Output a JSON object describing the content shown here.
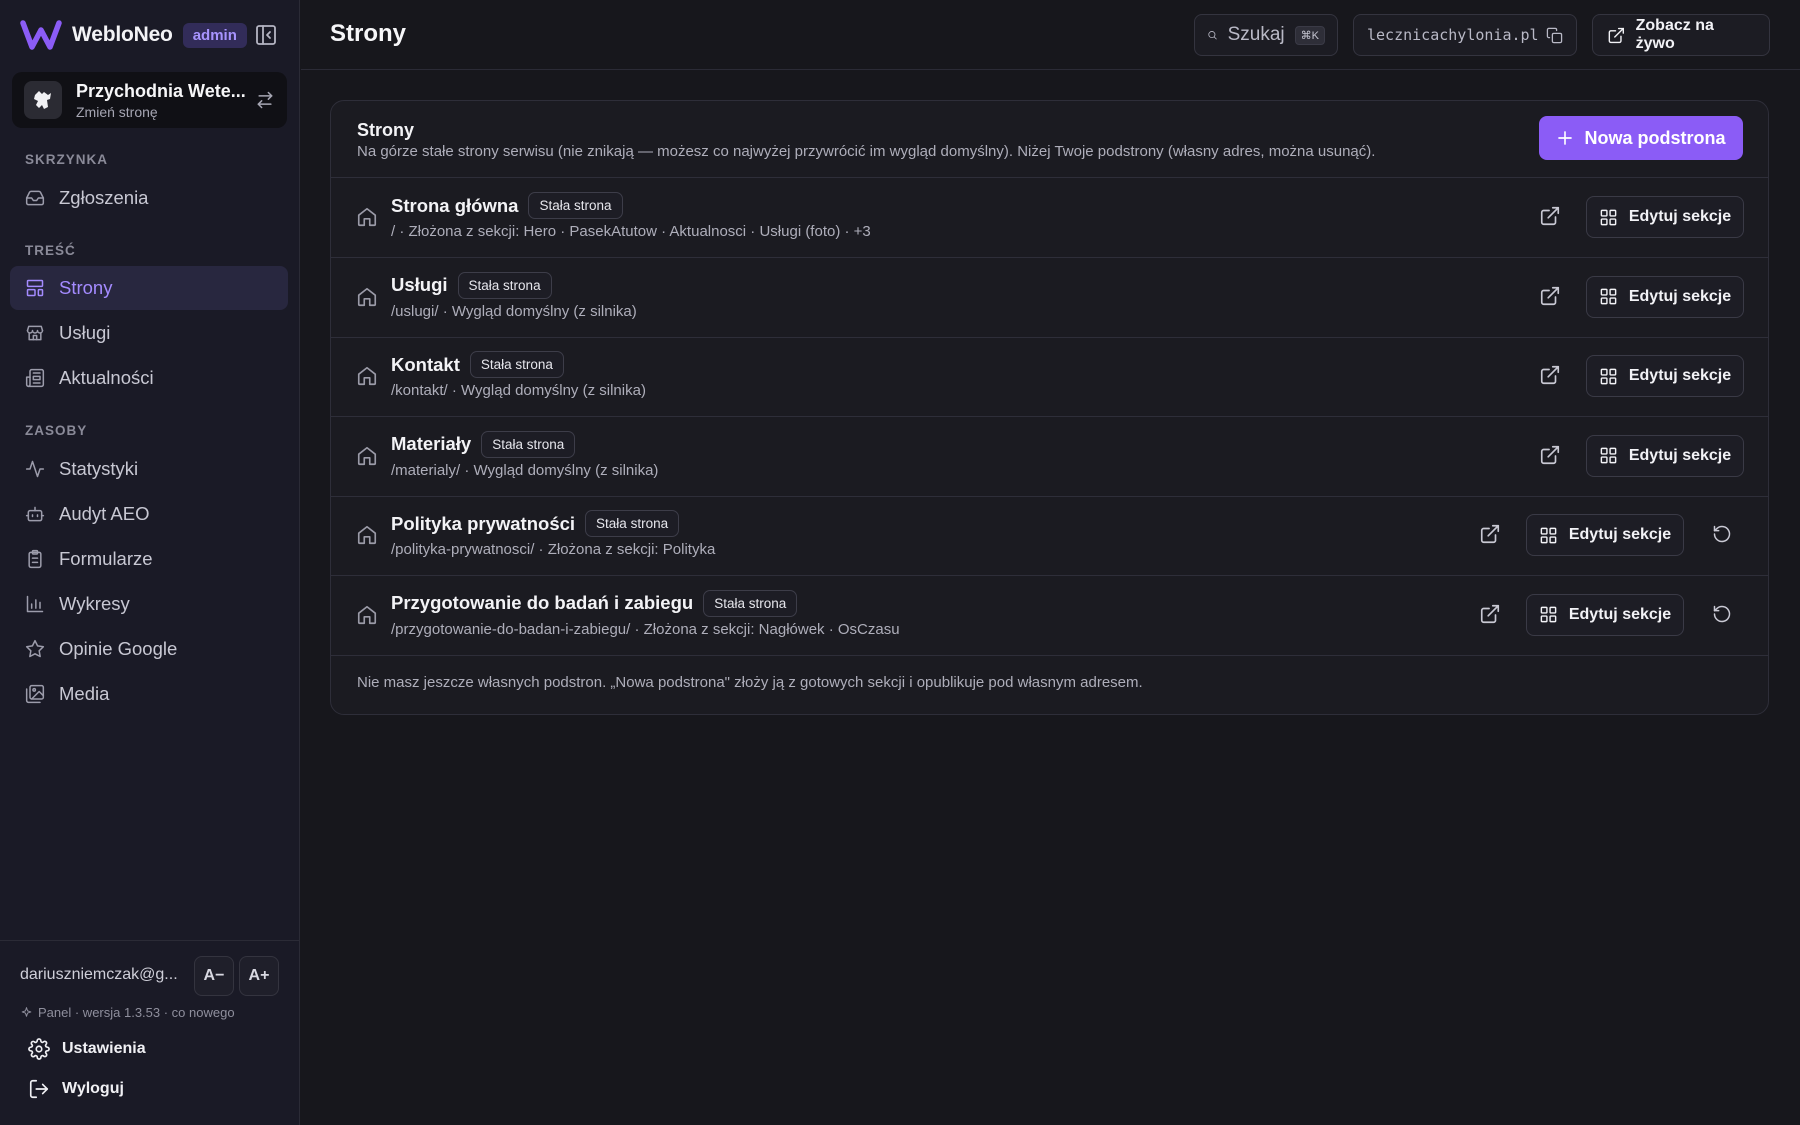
{
  "brand": {
    "name": "WebloNeo",
    "role_badge": "admin"
  },
  "site": {
    "name": "Przychodnia Wete...",
    "change_label": "Zmień stronę"
  },
  "sidebar": {
    "sections": [
      {
        "title": "SKRZYNKA",
        "items": [
          {
            "label": "Zgłoszenia",
            "icon": "inbox-icon"
          }
        ]
      },
      {
        "title": "TREŚĆ",
        "items": [
          {
            "label": "Strony",
            "icon": "layout-icon",
            "active": true
          },
          {
            "label": "Usługi",
            "icon": "store-icon"
          },
          {
            "label": "Aktualności",
            "icon": "newspaper-icon"
          }
        ]
      },
      {
        "title": "ZASOBY",
        "items": [
          {
            "label": "Statystyki",
            "icon": "activity-icon"
          },
          {
            "label": "Audyt AEO",
            "icon": "bot-icon"
          },
          {
            "label": "Formularze",
            "icon": "clipboard-icon"
          },
          {
            "label": "Wykresy",
            "icon": "bar-chart-icon"
          },
          {
            "label": "Opinie Google",
            "icon": "star-icon"
          },
          {
            "label": "Media",
            "icon": "images-icon"
          }
        ]
      }
    ],
    "footer": {
      "email": "dariuszniemczak@g...",
      "font_decrease": "A−",
      "font_increase": "A+",
      "version": "Panel · wersja 1.3.53 · co nowego",
      "settings_label": "Ustawienia",
      "logout_label": "Wyloguj"
    }
  },
  "topbar": {
    "title": "Strony",
    "search_label": "Szukaj",
    "search_shortcut": "⌘K",
    "domain": "lecznicachylonia.pl",
    "live_label": "Zobacz na żywo"
  },
  "pages_card": {
    "title": "Strony",
    "description": "Na górze stałe strony serwisu (nie znikają — możesz co najwyżej przywrócić im wygląd domyślny). Niżej Twoje podstrony (własny adres, można usunąć).",
    "new_button": "Nowa podstrona",
    "edit_label": "Edytuj sekcje",
    "fixed_badge": "Stała strona",
    "rows": [
      {
        "title": "Strona główna",
        "sub": "/ · Złożona z sekcji: Hero · PasekAtutow · Aktualnosci · Usługi (foto) · +3",
        "resettable": false
      },
      {
        "title": "Usługi",
        "sub": "/uslugi/ · Wygląd domyślny (z silnika)",
        "resettable": false
      },
      {
        "title": "Kontakt",
        "sub": "/kontakt/ · Wygląd domyślny (z silnika)",
        "resettable": false
      },
      {
        "title": "Materiały",
        "sub": "/materialy/ · Wygląd domyślny (z silnika)",
        "resettable": false
      },
      {
        "title": "Polityka prywatności",
        "sub": "/polityka-prywatnosci/ · Złożona z sekcji: Polityka",
        "resettable": true
      },
      {
        "title": "Przygotowanie do badań i zabiegu",
        "sub": "/przygotowanie-do-badan-i-zabiegu/ · Złożona z sekcji: Nagłówek · OsCzasu",
        "resettable": true
      }
    ],
    "empty_note": "Nie masz jeszcze własnych podstron. „Nowa podstrona\" złoży ją z gotowych sekcji i opublikuje pod własnym adresem."
  },
  "colors": {
    "accent": "#8b5cf6",
    "background": "#17171c",
    "sidebar": "#1a1a26",
    "active_nav": "#28273f"
  }
}
